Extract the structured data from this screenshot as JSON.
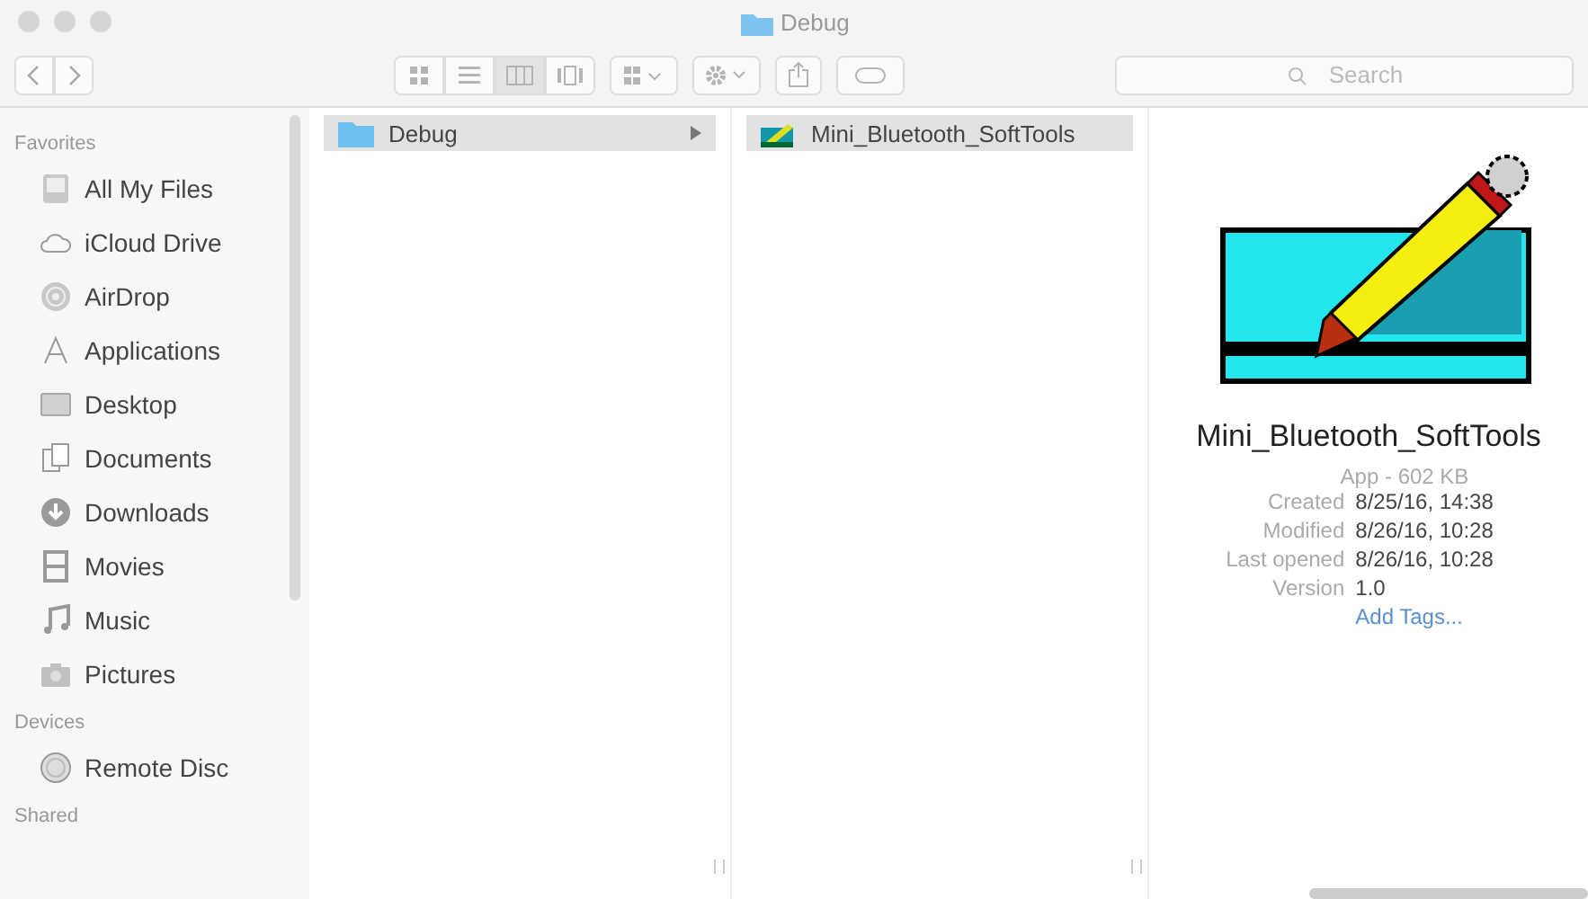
{
  "window": {
    "title": "Debug"
  },
  "toolbar": {
    "view_modes": [
      {
        "selected": false
      },
      {
        "selected": false
      },
      {
        "selected": true
      },
      {
        "selected": false
      }
    ],
    "search": {
      "placeholder": "Search"
    }
  },
  "sidebar": {
    "sections": [
      {
        "title": "Favorites",
        "items": [
          "All My Files",
          "iCloud Drive",
          "AirDrop",
          "Applications",
          "Desktop",
          "Documents",
          "Downloads",
          "Movies",
          "Music",
          "Pictures"
        ]
      },
      {
        "title": "Devices",
        "items": [
          "Remote Disc"
        ]
      },
      {
        "title": "Shared"
      }
    ]
  },
  "columns": [
    {
      "items": [
        {
          "name": "Debug",
          "kind": "folder",
          "selected": true
        }
      ]
    },
    {
      "items": [
        {
          "name": "Mini_Bluetooth_SoftTools",
          "kind": "app",
          "selected": true
        }
      ]
    }
  ],
  "preview": {
    "name": "Mini_Bluetooth_SoftTools",
    "kind_size": "App - 602 KB",
    "details": [
      {
        "label": "Created",
        "value": "8/25/16, 14:38"
      },
      {
        "label": "Modified",
        "value": "8/26/16, 10:28"
      },
      {
        "label": "Last opened",
        "value": "8/26/16, 10:28"
      },
      {
        "label": "Version",
        "value": "1.0"
      }
    ],
    "tags_link": "Add Tags..."
  }
}
